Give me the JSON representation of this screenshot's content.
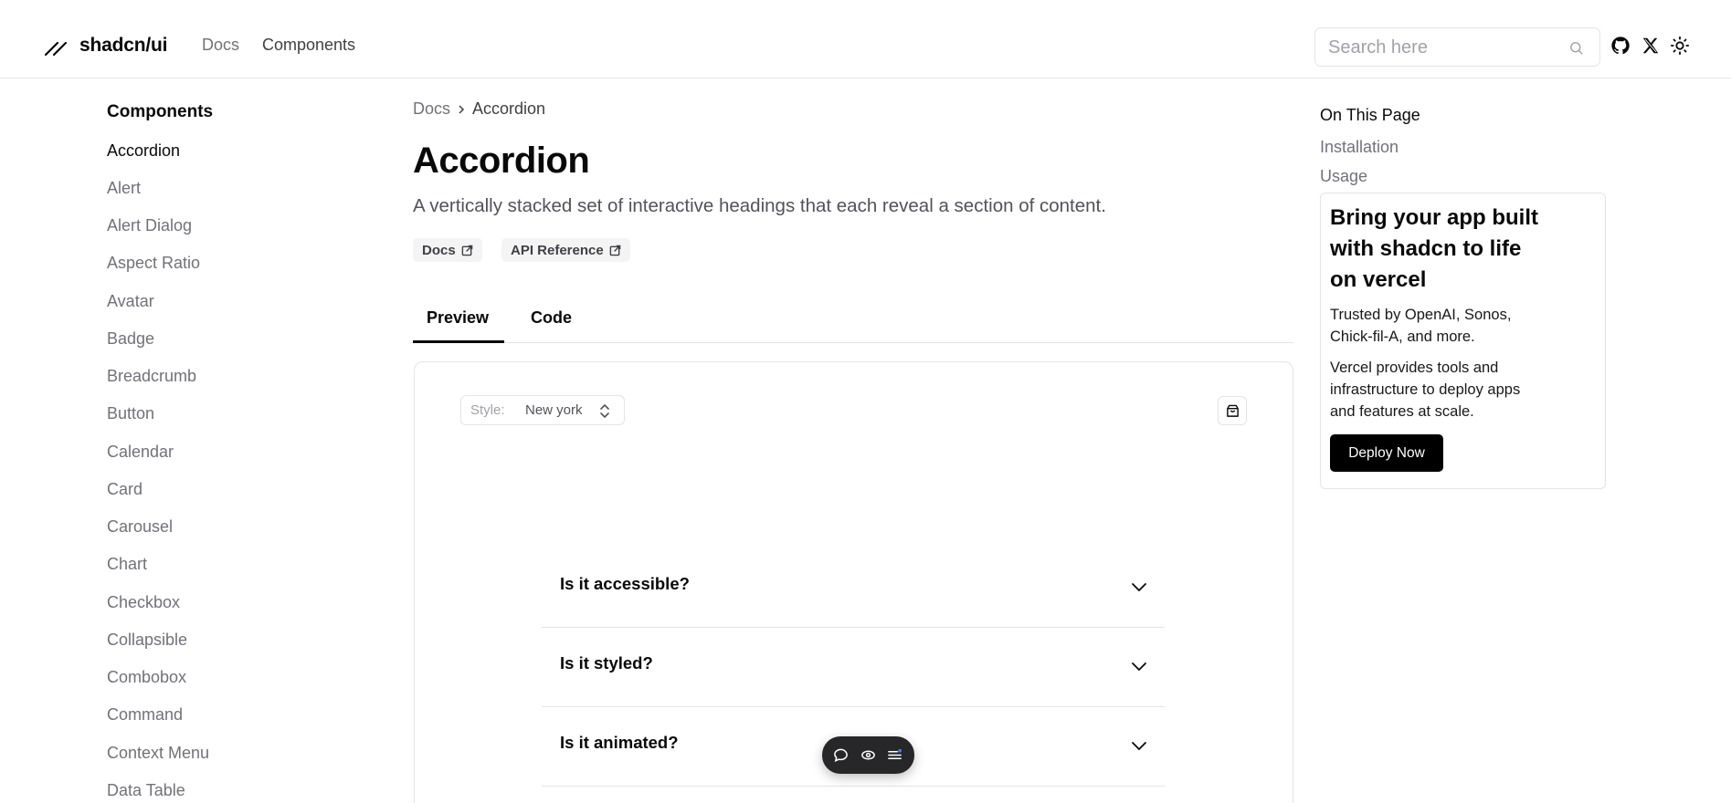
{
  "header": {
    "brand": "shadcn/ui",
    "nav": [
      "Docs",
      "Components"
    ],
    "search_placeholder": "Search here",
    "icons": [
      "github-icon",
      "x-icon",
      "sun-icon"
    ]
  },
  "sidebar": {
    "title": "Components",
    "items": [
      "Accordion",
      "Alert",
      "Alert Dialog",
      "Aspect Ratio",
      "Avatar",
      "Badge",
      "Breadcrumb",
      "Button",
      "Calendar",
      "Card",
      "Carousel",
      "Chart",
      "Checkbox",
      "Collapsible",
      "Combobox",
      "Command",
      "Context Menu",
      "Data Table"
    ],
    "active": "Accordion"
  },
  "breadcrumb": {
    "parent": "Docs",
    "current": "Accordion"
  },
  "page": {
    "title": "Accordion",
    "description": "A vertically stacked set of interactive headings that each reveal a section of content.",
    "badges": [
      "Docs",
      "API Reference"
    ],
    "tabs": [
      "Preview",
      "Code"
    ],
    "active_tab": "Preview"
  },
  "preview": {
    "style_label": "Style:",
    "style_value": "New york",
    "accordion": [
      "Is it accessible?",
      "Is it styled?",
      "Is it animated?"
    ]
  },
  "toc": {
    "title": "On This Page",
    "links": [
      "Installation",
      "Usage"
    ]
  },
  "promo": {
    "headline": "Bring your app built with shadcn to life on vercel",
    "trusted": "Trusted by OpenAI, Sonos, Chick-fil-A, and more.",
    "body": "Vercel provides tools and infrastructure to deploy apps and features at scale.",
    "cta": "Deploy Now"
  }
}
